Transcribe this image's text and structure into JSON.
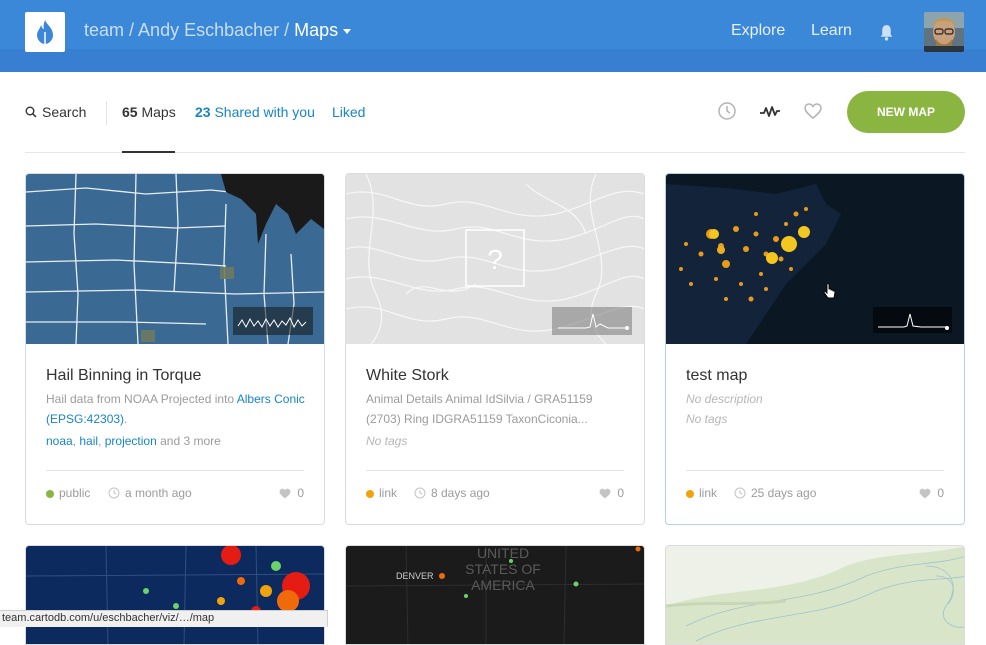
{
  "header": {
    "breadcrumb_team": "team /",
    "breadcrumb_user": "Andy Eschbacher /",
    "breadcrumb_current": "Maps",
    "nav_explore": "Explore",
    "nav_learn": "Learn",
    "logo_icon": "flame-drop-logo-icon",
    "bell_icon": "bell-icon"
  },
  "filters": {
    "search_label": "Search",
    "maps_count": "65",
    "maps_label": "Maps",
    "shared_count": "23",
    "shared_label": "Shared with you",
    "liked_label": "Liked",
    "new_map_label": "NEW MAP",
    "accent_color": "#8ab541"
  },
  "cards": [
    {
      "title": "Hail Binning in Torque",
      "desc_prefix": "Hail data from NOAA Projected into ",
      "desc_link": "Albers Conic (EPSG:42303)",
      "desc_suffix": ".",
      "tags": [
        "noaa",
        "hail",
        "projection"
      ],
      "tags_more": "and 3 more",
      "privacy": "public",
      "privacy_color": "#8ab541",
      "time": "a month ago",
      "likes": "0"
    },
    {
      "title": "White Stork",
      "desc": "Animal Details Animal IdSilvia / GRA51159 (2703) Ring IDGRA51159 TaxonCiconia...",
      "tags_empty": "No tags",
      "privacy": "link",
      "privacy_color": "#f0a30a",
      "time": "8 days ago",
      "likes": "0"
    },
    {
      "title": "test map",
      "desc_empty": "No description",
      "tags_empty": "No tags",
      "privacy": "link",
      "privacy_color": "#f0a30a",
      "time": "25 days ago",
      "likes": "0"
    }
  ],
  "row2": {
    "map_label_city": "DENVER",
    "map_label_country_1": "UNITED",
    "map_label_country_2": "STATES OF",
    "map_label_country_3": "AMERICA"
  },
  "statusbar": {
    "url": "team.cartodb.com/u/eschbacher/viz/…/map"
  }
}
